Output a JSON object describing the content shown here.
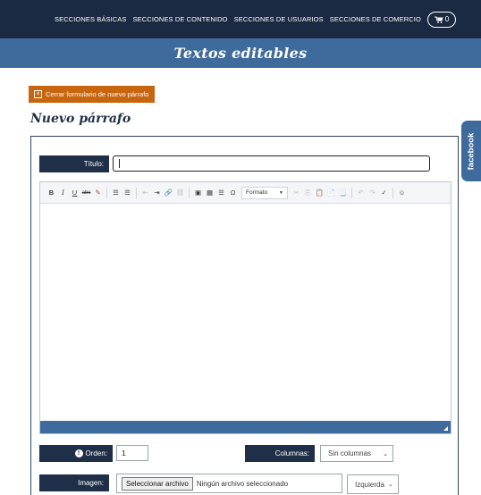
{
  "nav": {
    "items": [
      {
        "label": "SECCIONES BÁSICAS"
      },
      {
        "label": "SECCIONES DE CONTENIDO"
      },
      {
        "label": "SECCIONES DE USUARIOS"
      },
      {
        "label": "SECCIONES DE COMERCIO"
      }
    ],
    "cart_count": "0",
    "cart_icon": "cart-icon"
  },
  "banner": {
    "title": "Textos editables"
  },
  "close_button": {
    "label": "Cerrar formulario de nuevo párrafo",
    "icon": "close-box-icon"
  },
  "section_title": "Nuevo párrafo",
  "facebook_tab": "facebook",
  "form": {
    "title_label": "Título:",
    "title_value": "",
    "toolbar": {
      "format_label": "Formato"
    },
    "order_label": "Orden:",
    "order_value": "1",
    "columns_label": "Columnas:",
    "columns_value": "Sin columnas",
    "image_label": "Imagen:",
    "file_button": "Seleccionar archivo",
    "file_status": "Ningún archivo seleccionado",
    "align_value": "Izquierda"
  },
  "colors": {
    "nav_bg": "#1b2a42",
    "banner_bg": "#3e6a9c",
    "accent_orange": "#c8660f",
    "label_bg": "#1f2f48"
  }
}
